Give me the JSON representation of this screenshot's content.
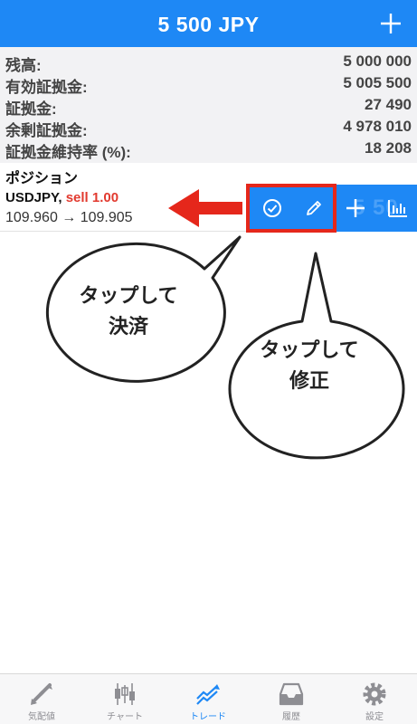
{
  "header": {
    "title": "5 500 JPY",
    "add_icon": "plus-icon"
  },
  "summary": [
    {
      "label": "残高:",
      "value": "5 000 000"
    },
    {
      "label": "有効証拠金:",
      "value": "5 005 500"
    },
    {
      "label": "証拠金:",
      "value": "27 490"
    },
    {
      "label": "余剰証拠金:",
      "value": "4 978 010"
    },
    {
      "label": "証拠金維持率 (%):",
      "value": "18 208"
    }
  ],
  "positions": {
    "title": "ポジション",
    "row": {
      "symbol": "USDJPY,",
      "side": "sell 1.00",
      "prices": "109.960 → 109.905",
      "hidden_profit": "5 50"
    },
    "actions": [
      "check-circle-icon",
      "pencil-icon",
      "plus-icon",
      "bar-chart-icon"
    ]
  },
  "annotations": {
    "close_bubble": [
      "タップして",
      "決済"
    ],
    "modify_bubble": [
      "タップして",
      "修正"
    ],
    "highlight_color": "#e5271b"
  },
  "tabs": [
    {
      "label": "気配値",
      "icon": "quotes-icon",
      "active": false
    },
    {
      "label": "チャート",
      "icon": "candlestick-icon",
      "active": false
    },
    {
      "label": "トレード",
      "icon": "trade-icon",
      "active": true
    },
    {
      "label": "履歴",
      "icon": "history-icon",
      "active": false
    },
    {
      "label": "設定",
      "icon": "settings-icon",
      "active": false
    }
  ],
  "colors": {
    "accent": "#1e88f5",
    "sell": "#e23a2f",
    "annotation_red": "#e5271b"
  }
}
